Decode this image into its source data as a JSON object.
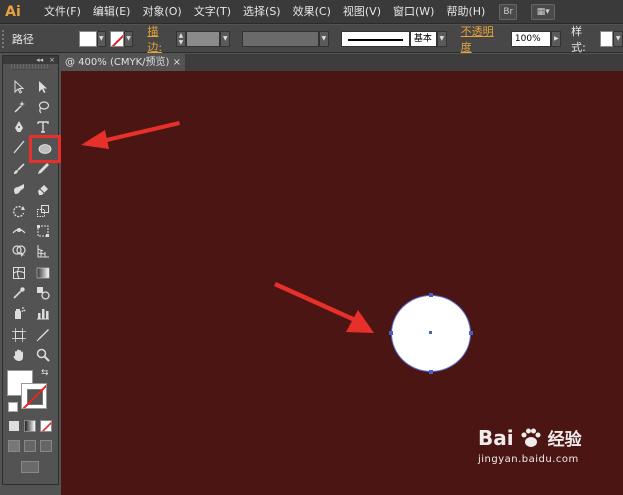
{
  "app": {
    "logo": "Ai"
  },
  "menu": [
    "文件(F)",
    "编辑(E)",
    "对象(O)",
    "文字(T)",
    "选择(S)",
    "效果(C)",
    "视图(V)",
    "窗口(W)",
    "帮助(H)"
  ],
  "menu_buttons": [
    "Br",
    "▦▾"
  ],
  "control_bar": {
    "object_label": "路径",
    "stroke_label": "描边:",
    "stroke_style": "基本",
    "opacity_label": "不透明度",
    "opacity_value": "100%",
    "style_label": "样式:"
  },
  "document_tab": {
    "title": "@ 400% (CMYK/预览)",
    "close": "×"
  },
  "colors": {
    "canvas": "#4a1513",
    "highlight": "#e8302a",
    "arrow": "#e8302a",
    "selection": "#4a5fc8",
    "fill": "#ffffff"
  },
  "tools": [
    "selection-tool-icon",
    "direct-selection-tool-icon",
    "magic-wand-tool-icon",
    "lasso-tool-icon",
    "pen-tool-icon",
    "type-tool-icon",
    "line-tool-icon",
    "ellipse-tool-icon",
    "paintbrush-tool-icon",
    "pencil-tool-icon",
    "blob-brush-tool-icon",
    "eraser-tool-icon",
    "rotate-tool-icon",
    "scale-tool-icon",
    "width-tool-icon",
    "free-transform-tool-icon",
    "shape-builder-tool-icon",
    "perspective-grid-tool-icon",
    "mesh-tool-icon",
    "gradient-tool-icon",
    "eyedropper-tool-icon",
    "blend-tool-icon",
    "symbol-sprayer-tool-icon",
    "column-graph-tool-icon",
    "artboard-tool-icon",
    "slice-tool-icon",
    "hand-tool-icon",
    "zoom-tool-icon"
  ],
  "active_tool": "ellipse-tool-icon",
  "watermark": {
    "brand": "Bai",
    "brand_suffix": "经验",
    "url": "jingyan.baidu.com"
  }
}
